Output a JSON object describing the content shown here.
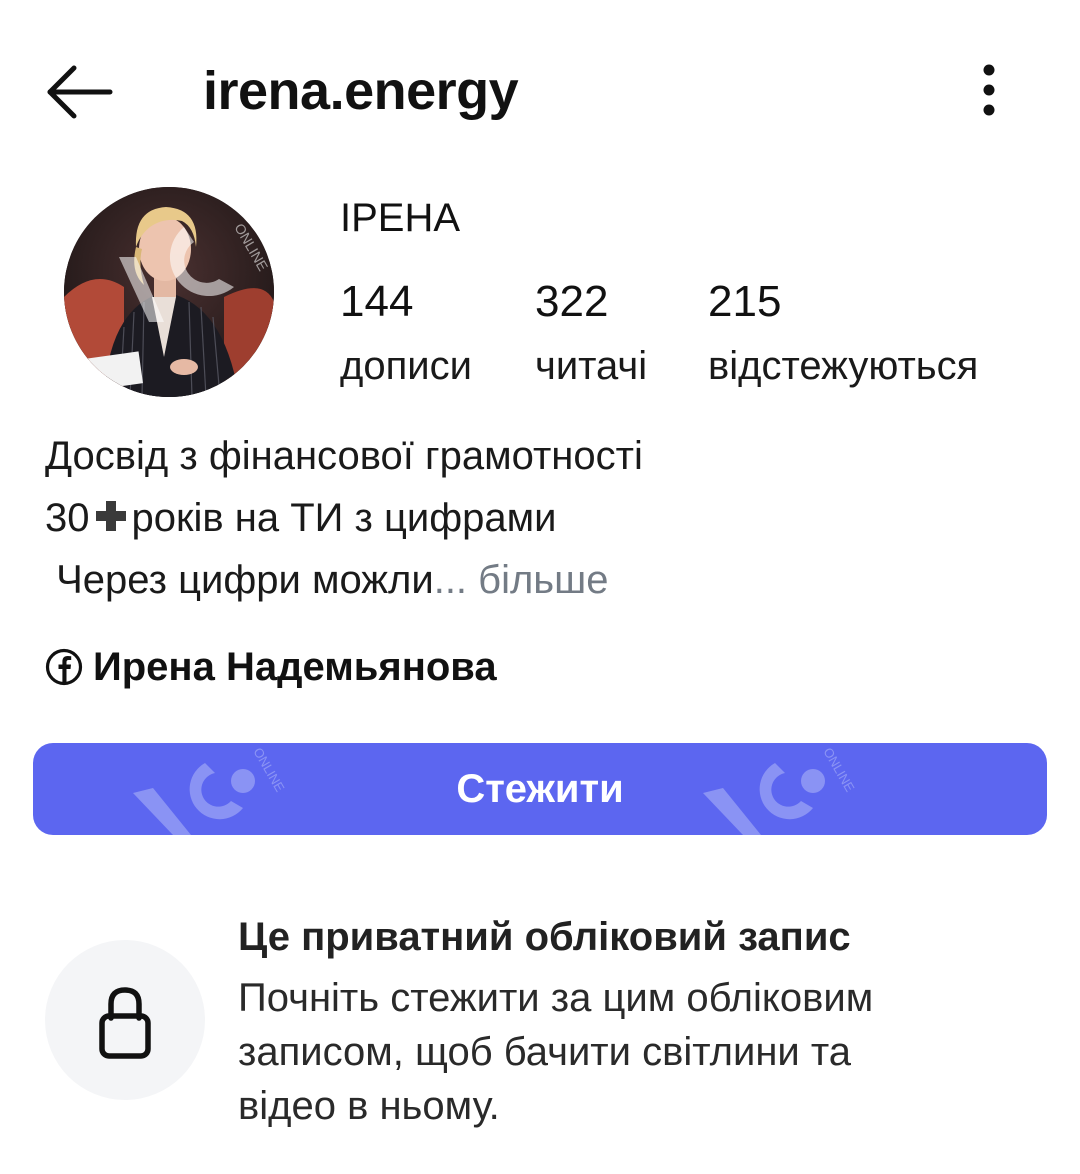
{
  "header": {
    "username": "irena.energy",
    "back_icon": "arrow-left-icon",
    "menu_icon": "more-vertical-icon"
  },
  "profile": {
    "display_name": "ІРЕНА",
    "avatar_watermark": "УЦ ONLINE",
    "stats": [
      {
        "value": "144",
        "label": "дописи"
      },
      {
        "value": "322",
        "label": "читачі"
      },
      {
        "value": "215",
        "label": "відстежуються"
      }
    ],
    "bio": {
      "line1": "Досвід з фінансової грамотності",
      "line2_before": "30",
      "line2_after": "років на ТИ з цифрами",
      "line3": " Через цифри можли",
      "ellipsis": "...",
      "more_label": " більше"
    },
    "facebook": {
      "icon": "facebook-icon",
      "name": "Ирена Надемьянова"
    }
  },
  "actions": {
    "follow_label": "Стежити",
    "watermark_text": "ONLINE"
  },
  "private_notice": {
    "icon": "lock-icon",
    "title": "Це приватний обліковий запис",
    "desc_lines": [
      "Почніть стежити за цим обліковим",
      "записом, щоб бачити світлини та",
      "відео в ньому."
    ]
  },
  "colors": {
    "accent": "#5c66f0",
    "muted": "#737b85",
    "lock_bg": "#f4f5f7"
  }
}
